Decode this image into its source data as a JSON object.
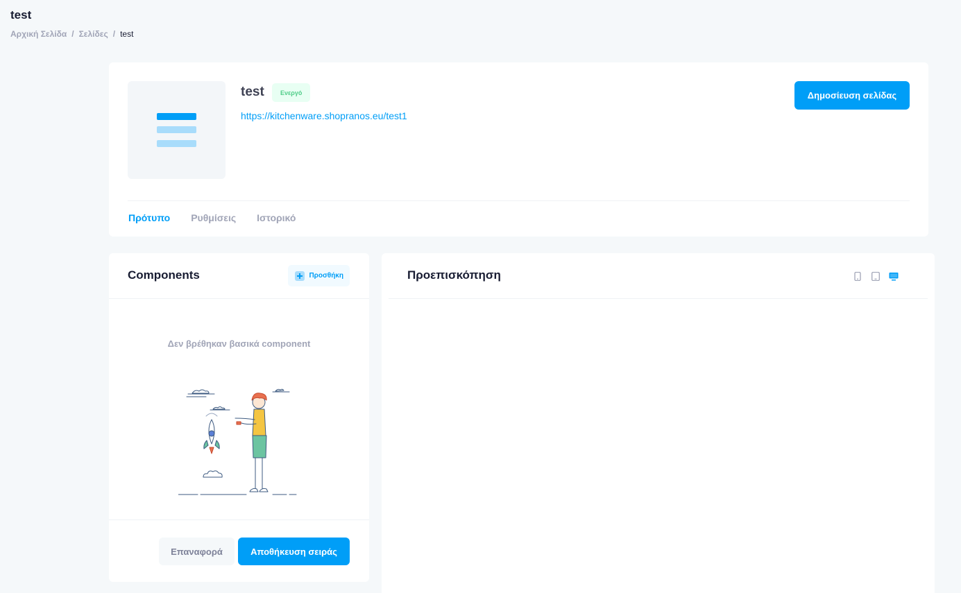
{
  "page": {
    "title": "test",
    "breadcrumb": [
      "Αρχική Σελίδα",
      "Σελίδες",
      "test"
    ]
  },
  "header": {
    "name": "test",
    "status_badge": "Ενεργό",
    "url": "https://kitchenware.shopranos.eu/test1",
    "publish_label": "Δημοσίευση σελίδας",
    "tabs": [
      {
        "label": "Πρότυπο",
        "active": true
      },
      {
        "label": "Ρυθμίσεις",
        "active": false
      },
      {
        "label": "Ιστορικό",
        "active": false
      }
    ]
  },
  "components": {
    "title": "Components",
    "add_label": "Προσθήκη",
    "empty_message": "Δεν βρέθηκαν βασικά component",
    "reset_label": "Επαναφορά",
    "save_label": "Αποθήκευση σειράς"
  },
  "preview": {
    "title": "Προεπισκόπηση",
    "devices": [
      {
        "icon": "mobile-icon",
        "active": false
      },
      {
        "icon": "tablet-icon",
        "active": false
      },
      {
        "icon": "desktop-icon",
        "active": true
      }
    ]
  },
  "colors": {
    "primary": "#009ef7",
    "success": "#50cd89",
    "muted": "#a1a5b7",
    "background": "#f5f8fa"
  }
}
